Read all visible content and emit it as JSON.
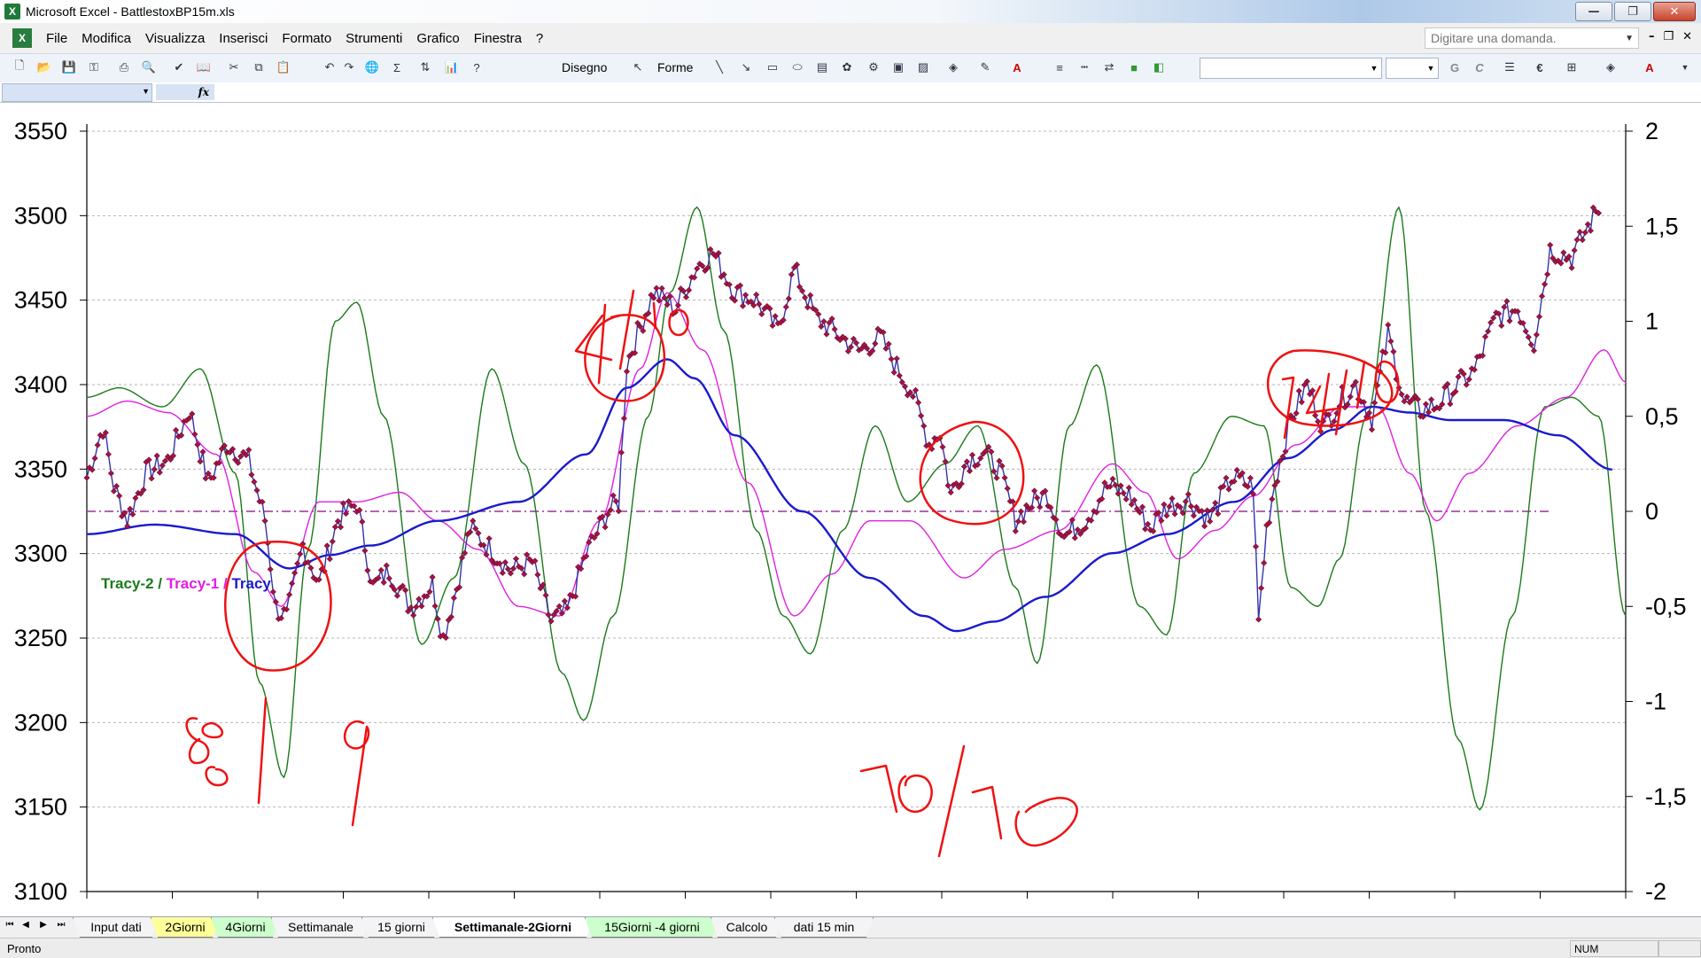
{
  "window": {
    "title": "Microsoft Excel - BattlestoxBP15m.xls",
    "app_icon": "excel-icon",
    "controls": [
      "minimize",
      "restore",
      "close"
    ]
  },
  "menu": {
    "items": [
      "File",
      "Modifica",
      "Visualizza",
      "Inserisci",
      "Formato",
      "Strumenti",
      "Grafico",
      "Finestra",
      "?"
    ],
    "help_placeholder": "Digitare una domanda."
  },
  "toolbar": {
    "draw_label": "Disegno",
    "shapes_label": "Forme",
    "bold_label": "G",
    "italic_label": "C",
    "sum_label": "Σ",
    "euro_label": "€",
    "font_color_label": "A"
  },
  "formula_bar": {
    "name_box": "",
    "fx_label": "fx"
  },
  "chart_data": {
    "type": "line",
    "y_left": {
      "min": 3100,
      "max": 3550,
      "step": 50,
      "ticks": [
        3100,
        3150,
        3200,
        3250,
        3300,
        3350,
        3400,
        3450,
        3500,
        3550
      ]
    },
    "y_right": {
      "min": -2,
      "max": 2,
      "ticks": [
        "-2",
        "-1,5",
        "-1",
        "-0,5",
        "0",
        "0,5",
        "1",
        "1,5",
        "2"
      ]
    },
    "grid": true,
    "zero_line": {
      "axis": "right",
      "value": 0,
      "style": "dash-dot",
      "color": "#993399"
    },
    "legend": {
      "position": "left-middle",
      "entries": [
        {
          "name": "Tracy-2",
          "color": "#1a7a1a"
        },
        {
          "name": "Tracy-1",
          "color": "#e020e0"
        },
        {
          "name": "Tracy",
          "color": "#1a1acc"
        }
      ],
      "separator": " / "
    },
    "price": {
      "color": "#3333aa",
      "marker_color": "#aa1144",
      "axis": "left",
      "anchors": [
        [
          0,
          3345
        ],
        [
          6,
          3375
        ],
        [
          10,
          3340
        ],
        [
          15,
          3320
        ],
        [
          22,
          3348
        ],
        [
          30,
          3355
        ],
        [
          38,
          3385
        ],
        [
          45,
          3342
        ],
        [
          52,
          3365
        ],
        [
          60,
          3355
        ],
        [
          66,
          3320
        ],
        [
          70,
          3268
        ],
        [
          74,
          3262
        ],
        [
          80,
          3305
        ],
        [
          86,
          3282
        ],
        [
          93,
          3320
        ],
        [
          100,
          3330
        ],
        [
          106,
          3280
        ],
        [
          112,
          3290
        ],
        [
          120,
          3268
        ],
        [
          128,
          3282
        ],
        [
          132,
          3250
        ],
        [
          137,
          3280
        ],
        [
          142,
          3315
        ],
        [
          150,
          3302
        ],
        [
          157,
          3290
        ],
        [
          165,
          3295
        ],
        [
          172,
          3260
        ],
        [
          178,
          3266
        ],
        [
          185,
          3300
        ],
        [
          193,
          3325
        ],
        [
          197,
          3330
        ],
        [
          200,
          3412
        ],
        [
          204,
          3430
        ],
        [
          210,
          3455
        ],
        [
          218,
          3445
        ],
        [
          226,
          3470
        ],
        [
          232,
          3478
        ],
        [
          240,
          3455
        ],
        [
          248,
          3450
        ],
        [
          256,
          3432
        ],
        [
          262,
          3468
        ],
        [
          270,
          3440
        ],
        [
          278,
          3430
        ],
        [
          286,
          3420
        ],
        [
          294,
          3428
        ],
        [
          300,
          3410
        ],
        [
          306,
          3395
        ],
        [
          312,
          3365
        ],
        [
          316,
          3372
        ],
        [
          320,
          3335
        ],
        [
          326,
          3355
        ],
        [
          332,
          3360
        ],
        [
          338,
          3350
        ],
        [
          344,
          3320
        ],
        [
          350,
          3330
        ],
        [
          356,
          3335
        ],
        [
          362,
          3310
        ],
        [
          370,
          3320
        ],
        [
          378,
          3340
        ],
        [
          386,
          3335
        ],
        [
          394,
          3315
        ],
        [
          400,
          3328
        ],
        [
          408,
          3332
        ],
        [
          416,
          3320
        ],
        [
          424,
          3345
        ],
        [
          432,
          3340
        ],
        [
          434,
          3260
        ],
        [
          437,
          3315
        ],
        [
          440,
          3342
        ],
        [
          446,
          3380
        ],
        [
          452,
          3400
        ],
        [
          458,
          3375
        ],
        [
          464,
          3390
        ],
        [
          470,
          3400
        ],
        [
          476,
          3380
        ],
        [
          482,
          3430
        ],
        [
          488,
          3390
        ],
        [
          494,
          3385
        ],
        [
          500,
          3388
        ],
        [
          508,
          3400
        ],
        [
          514,
          3408
        ],
        [
          522,
          3440
        ],
        [
          530,
          3445
        ],
        [
          536,
          3425
        ],
        [
          542,
          3480
        ],
        [
          550,
          3475
        ],
        [
          560,
          3505
        ]
      ]
    },
    "tracy": {
      "color": "#1a1acc",
      "axis": "right",
      "anchors": [
        [
          0,
          -0.12
        ],
        [
          25,
          -0.07
        ],
        [
          55,
          -0.12
        ],
        [
          75,
          -0.3
        ],
        [
          90,
          -0.23
        ],
        [
          105,
          -0.18
        ],
        [
          130,
          -0.05
        ],
        [
          160,
          0.05
        ],
        [
          185,
          0.3
        ],
        [
          200,
          0.65
        ],
        [
          215,
          0.8
        ],
        [
          225,
          0.7
        ],
        [
          240,
          0.4
        ],
        [
          265,
          0.0
        ],
        [
          290,
          -0.35
        ],
        [
          310,
          -0.55
        ],
        [
          322,
          -0.63
        ],
        [
          336,
          -0.58
        ],
        [
          355,
          -0.45
        ],
        [
          380,
          -0.22
        ],
        [
          400,
          -0.12
        ],
        [
          425,
          0.05
        ],
        [
          445,
          0.28
        ],
        [
          462,
          0.43
        ],
        [
          476,
          0.55
        ],
        [
          490,
          0.52
        ],
        [
          505,
          0.48
        ],
        [
          525,
          0.48
        ],
        [
          545,
          0.4
        ],
        [
          565,
          0.22
        ]
      ]
    },
    "tracy_1": {
      "color": "#e020e0",
      "axis": "right",
      "anchors": [
        [
          0,
          0.5
        ],
        [
          15,
          0.58
        ],
        [
          30,
          0.52
        ],
        [
          48,
          0.3
        ],
        [
          62,
          -0.32
        ],
        [
          72,
          -0.5
        ],
        [
          86,
          0.05
        ],
        [
          100,
          0.05
        ],
        [
          116,
          0.1
        ],
        [
          130,
          -0.05
        ],
        [
          145,
          -0.2
        ],
        [
          160,
          -0.5
        ],
        [
          175,
          -0.55
        ],
        [
          190,
          -0.05
        ],
        [
          205,
          0.75
        ],
        [
          215,
          1.15
        ],
        [
          228,
          0.85
        ],
        [
          245,
          0.15
        ],
        [
          262,
          -0.55
        ],
        [
          276,
          -0.33
        ],
        [
          290,
          -0.05
        ],
        [
          305,
          -0.05
        ],
        [
          325,
          -0.35
        ],
        [
          340,
          -0.2
        ],
        [
          360,
          -0.1
        ],
        [
          380,
          0.25
        ],
        [
          392,
          0.1
        ],
        [
          404,
          -0.25
        ],
        [
          418,
          -0.1
        ],
        [
          432,
          0.08
        ],
        [
          448,
          0.35
        ],
        [
          465,
          0.55
        ],
        [
          478,
          0.55
        ],
        [
          490,
          0.2
        ],
        [
          500,
          -0.05
        ],
        [
          512,
          0.2
        ],
        [
          530,
          0.45
        ],
        [
          548,
          0.6
        ],
        [
          562,
          0.85
        ],
        [
          570,
          0.68
        ]
      ]
    },
    "tracy_2": {
      "color": "#1a7a1a",
      "axis": "right",
      "anchors": [
        [
          0,
          0.6
        ],
        [
          12,
          0.65
        ],
        [
          28,
          0.55
        ],
        [
          42,
          0.75
        ],
        [
          55,
          0.2
        ],
        [
          64,
          -0.9
        ],
        [
          73,
          -1.4
        ],
        [
          82,
          -0.2
        ],
        [
          92,
          1.0
        ],
        [
          100,
          1.1
        ],
        [
          110,
          0.5
        ],
        [
          124,
          -0.7
        ],
        [
          136,
          -0.35
        ],
        [
          150,
          0.75
        ],
        [
          162,
          0.25
        ],
        [
          176,
          -0.85
        ],
        [
          184,
          -1.1
        ],
        [
          195,
          -0.55
        ],
        [
          208,
          0.5
        ],
        [
          216,
          1.15
        ],
        [
          226,
          1.6
        ],
        [
          236,
          0.95
        ],
        [
          248,
          -0.1
        ],
        [
          258,
          -0.55
        ],
        [
          268,
          -0.75
        ],
        [
          280,
          -0.1
        ],
        [
          292,
          0.45
        ],
        [
          304,
          0.05
        ],
        [
          318,
          0.25
        ],
        [
          330,
          0.45
        ],
        [
          344,
          -0.4
        ],
        [
          352,
          -0.8
        ],
        [
          364,
          0.45
        ],
        [
          374,
          0.77
        ],
        [
          390,
          -0.5
        ],
        [
          400,
          -0.65
        ],
        [
          410,
          0.2
        ],
        [
          424,
          0.5
        ],
        [
          436,
          0.45
        ],
        [
          446,
          -0.4
        ],
        [
          456,
          -0.5
        ],
        [
          464,
          -0.25
        ],
        [
          474,
          0.5
        ],
        [
          486,
          1.6
        ],
        [
          496,
          0.0
        ],
        [
          508,
          -1.2
        ],
        [
          516,
          -1.57
        ],
        [
          528,
          -0.55
        ],
        [
          540,
          0.55
        ],
        [
          550,
          0.6
        ],
        [
          560,
          0.5
        ],
        [
          570,
          -0.55
        ]
      ]
    }
  },
  "annotations": [
    "8/9",
    "4/10",
    "10/10",
    "14/10"
  ],
  "sheet_tabs": {
    "active_index": 5,
    "tabs": [
      {
        "label": "Input dati",
        "color": "#ffffff"
      },
      {
        "label": "2Giorni",
        "color": "#ffff99"
      },
      {
        "label": "4Giorni",
        "color": "#ccffcc"
      },
      {
        "label": "Settimanale",
        "color": "#ffffff"
      },
      {
        "label": "15 giorni",
        "color": "#ffffff"
      },
      {
        "label": "Settimanale-2Giorni",
        "color": "#ffffff"
      },
      {
        "label": "15Giorni -4 giorni",
        "color": "#ccffcc"
      },
      {
        "label": "Calcolo",
        "color": "#ffffff"
      },
      {
        "label": "dati 15 min",
        "color": "#ffffff"
      }
    ]
  },
  "status": {
    "text": "Pronto",
    "num": "NUM"
  }
}
